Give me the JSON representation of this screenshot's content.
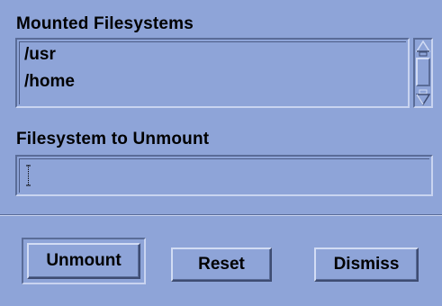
{
  "dialog": {
    "mounted_label": "Mounted Filesystems",
    "mounted_items": [
      "/usr",
      "/home"
    ],
    "unmount_label": "Filesystem to Unmount",
    "unmount_field_value": ""
  },
  "buttons": {
    "unmount": "Unmount",
    "reset": "Reset",
    "dismiss": "Dismiss",
    "default": "unmount"
  },
  "icons": {
    "scroll_up": "up-arrow-icon",
    "scroll_down": "down-arrow-icon",
    "caret": "text-cursor-icon"
  },
  "colors": {
    "background": "#8ea4d8",
    "shadow": "#5a6c98",
    "highlight": "#c9d4f0",
    "text": "#000000"
  }
}
